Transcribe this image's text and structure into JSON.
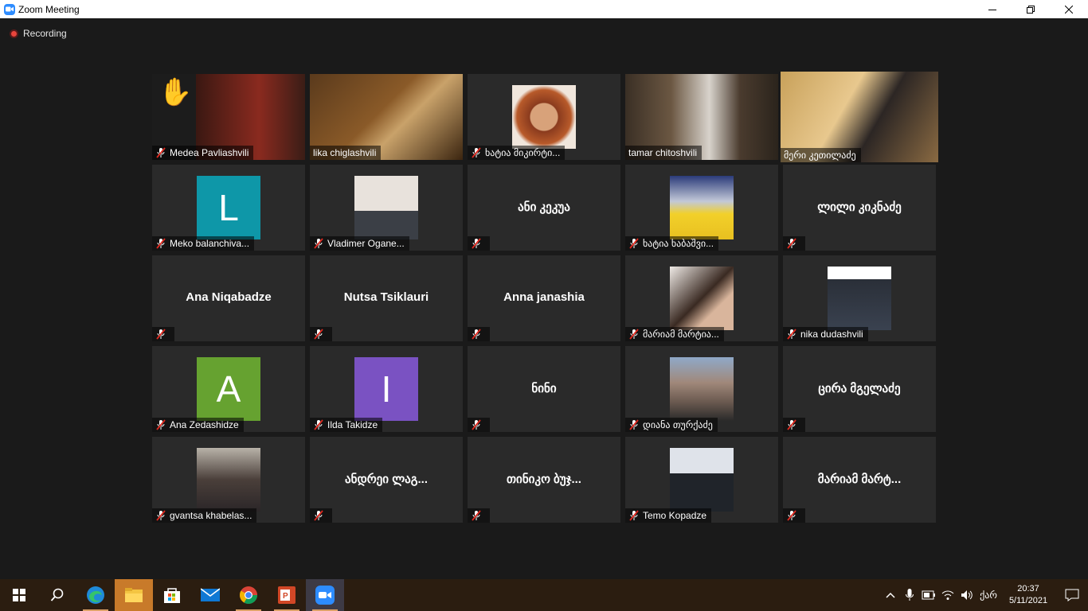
{
  "window": {
    "title": "Zoom Meeting",
    "controls": [
      "minimize-icon",
      "restore-icon",
      "close-icon"
    ]
  },
  "recording": {
    "label": "Recording"
  },
  "participants": [
    {
      "name": "Medea Pavliashvili",
      "type": "video",
      "raised_hand": true
    },
    {
      "name": "lika chiglashvili",
      "type": "video",
      "muted": false
    },
    {
      "name": "ხატია მიკირტი...",
      "type": "photo"
    },
    {
      "name": "tamar chitoshvili",
      "type": "video",
      "muted": false
    },
    {
      "name": "მერი კეთილაძე",
      "type": "video",
      "active_speaker": true,
      "muted": false
    },
    {
      "name": "Meko balanchiva...",
      "type": "letter",
      "letter": "L",
      "color": "#0e97a8"
    },
    {
      "name": "Vladimer Ogane...",
      "type": "photo"
    },
    {
      "name": "ანი კეკუა",
      "type": "name"
    },
    {
      "name": "ხატია ხაბაშვი...",
      "type": "photo"
    },
    {
      "name": "ლილი კიკნაძე",
      "type": "name"
    },
    {
      "name": "Ana Niqabadze",
      "type": "name"
    },
    {
      "name": "Nutsa Tsiklauri",
      "type": "name"
    },
    {
      "name": "Anna janashia",
      "type": "name"
    },
    {
      "name": "მარიამ მარტია...",
      "type": "photo"
    },
    {
      "name": "nika dudashvili",
      "type": "photo"
    },
    {
      "name": "Ana Zedashidze",
      "type": "letter",
      "letter": "A",
      "color": "#66a230"
    },
    {
      "name": "Ilda Takidze",
      "type": "letter",
      "letter": "I",
      "color": "#7a52c2"
    },
    {
      "name": "ნინი",
      "type": "name"
    },
    {
      "name": "დიანა თურქაძე",
      "type": "photo"
    },
    {
      "name": "ცირა მგელაძე",
      "type": "name"
    },
    {
      "name": "gvantsa khabelas...",
      "type": "photo"
    },
    {
      "name": "ანდრეი ლაგ...",
      "type": "name"
    },
    {
      "name": "თინიკო  ბუჯ...",
      "type": "name"
    },
    {
      "name": "Temo Kopadze",
      "type": "photo"
    },
    {
      "name": "მარიამ მარტ...",
      "type": "name"
    }
  ],
  "taskbar": {
    "apps": [
      "windows-start",
      "search",
      "edge",
      "file-explorer",
      "store",
      "mail",
      "chrome",
      "powerpoint",
      "zoom"
    ],
    "tray": {
      "language": "ქარ",
      "time": "20:37",
      "date": "5/11/2021"
    }
  }
}
